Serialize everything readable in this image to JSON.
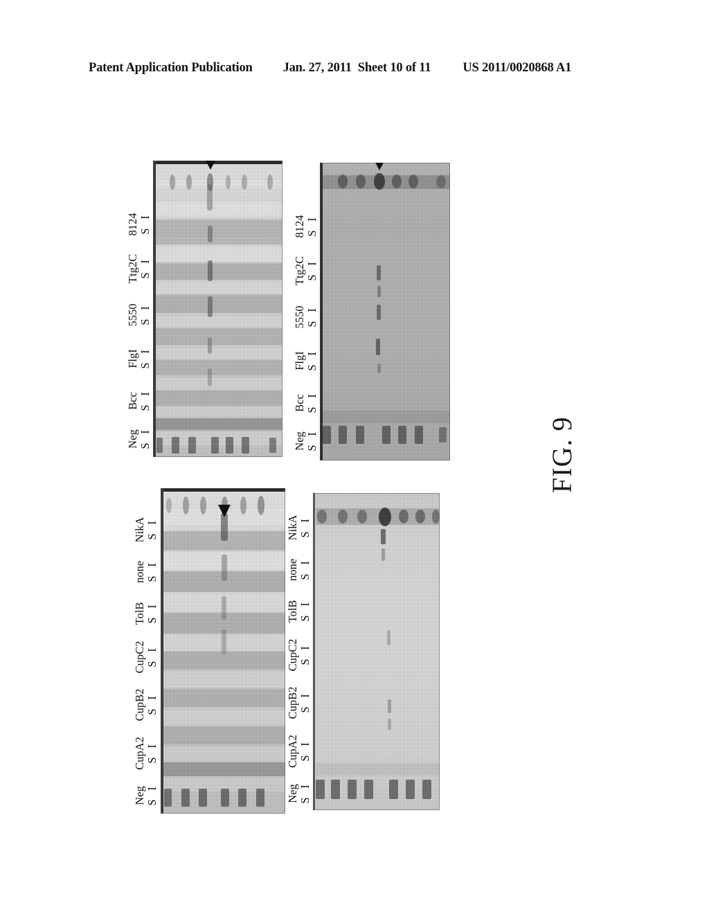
{
  "header": {
    "publication": "Patent Application Publication",
    "date": "Jan. 27, 2011",
    "sheet": "Sheet 10 of 11",
    "patent_number": "US 2011/0020868 A1"
  },
  "figure": {
    "caption": "FIG. 9",
    "colors": {
      "ink": "#111111",
      "gel_light": "#e9e9e9",
      "gel_dark": "#b9b9b9",
      "band_dark": "#4a4a4a",
      "marker": "#101010"
    }
  },
  "panels": [
    {
      "id": "top-left",
      "kind": "sds-page-gel",
      "description": "Coomassie-stained SDS-PAGE gel, upper left",
      "lane_sets": [
        {
          "name": "Neg",
          "fractions": [
            "S",
            "I"
          ]
        },
        {
          "name": "Bcc",
          "fractions": [
            "S",
            "I"
          ]
        },
        {
          "name": "FlgI",
          "fractions": [
            "S",
            "I"
          ]
        },
        {
          "name": "5550",
          "fractions": [
            "S",
            "I"
          ]
        },
        {
          "name": "Ttg2C",
          "fractions": [
            "S",
            "I"
          ]
        },
        {
          "name": "8124",
          "fractions": [
            "S",
            "I"
          ]
        }
      ]
    },
    {
      "id": "top-right",
      "kind": "western-blot",
      "description": "Anti-His western blot, upper right",
      "lane_sets": [
        {
          "name": "Neg",
          "fractions": [
            "S",
            "I"
          ]
        },
        {
          "name": "Bcc",
          "fractions": [
            "S",
            "I"
          ]
        },
        {
          "name": "FlgI",
          "fractions": [
            "S",
            "I"
          ]
        },
        {
          "name": "5550",
          "fractions": [
            "S",
            "I"
          ]
        },
        {
          "name": "Ttg2C",
          "fractions": [
            "S",
            "I"
          ]
        },
        {
          "name": "8124",
          "fractions": [
            "S",
            "I"
          ]
        }
      ]
    },
    {
      "id": "bottom-left",
      "kind": "sds-page-gel",
      "description": "Coomassie-stained SDS-PAGE gel, lower left",
      "lane_sets": [
        {
          "name": "Neg",
          "fractions": [
            "S",
            "I"
          ]
        },
        {
          "name": "CupA2",
          "fractions": [
            "S",
            "I"
          ]
        },
        {
          "name": "CupB2",
          "fractions": [
            "S",
            "I"
          ]
        },
        {
          "name": "CupC2",
          "fractions": [
            "S",
            "I"
          ]
        },
        {
          "name": "TolB",
          "fractions": [
            "S",
            "I"
          ]
        },
        {
          "name": "none",
          "fractions": [
            "S",
            "I"
          ]
        },
        {
          "name": "NikA",
          "fractions": [
            "S",
            "I"
          ]
        }
      ]
    },
    {
      "id": "bottom-right",
      "kind": "western-blot",
      "description": "Anti-His western blot, lower right",
      "lane_sets": [
        {
          "name": "Neg",
          "fractions": [
            "S",
            "I"
          ]
        },
        {
          "name": "CupA2",
          "fractions": [
            "S",
            "I"
          ]
        },
        {
          "name": "CupB2",
          "fractions": [
            "S",
            "I"
          ]
        },
        {
          "name": "CupC2",
          "fractions": [
            "S",
            "I"
          ]
        },
        {
          "name": "TolB",
          "fractions": [
            "S",
            "I"
          ]
        },
        {
          "name": "none",
          "fractions": [
            "S",
            "I"
          ]
        },
        {
          "name": "NikA",
          "fractions": [
            "S",
            "I"
          ]
        }
      ]
    }
  ]
}
